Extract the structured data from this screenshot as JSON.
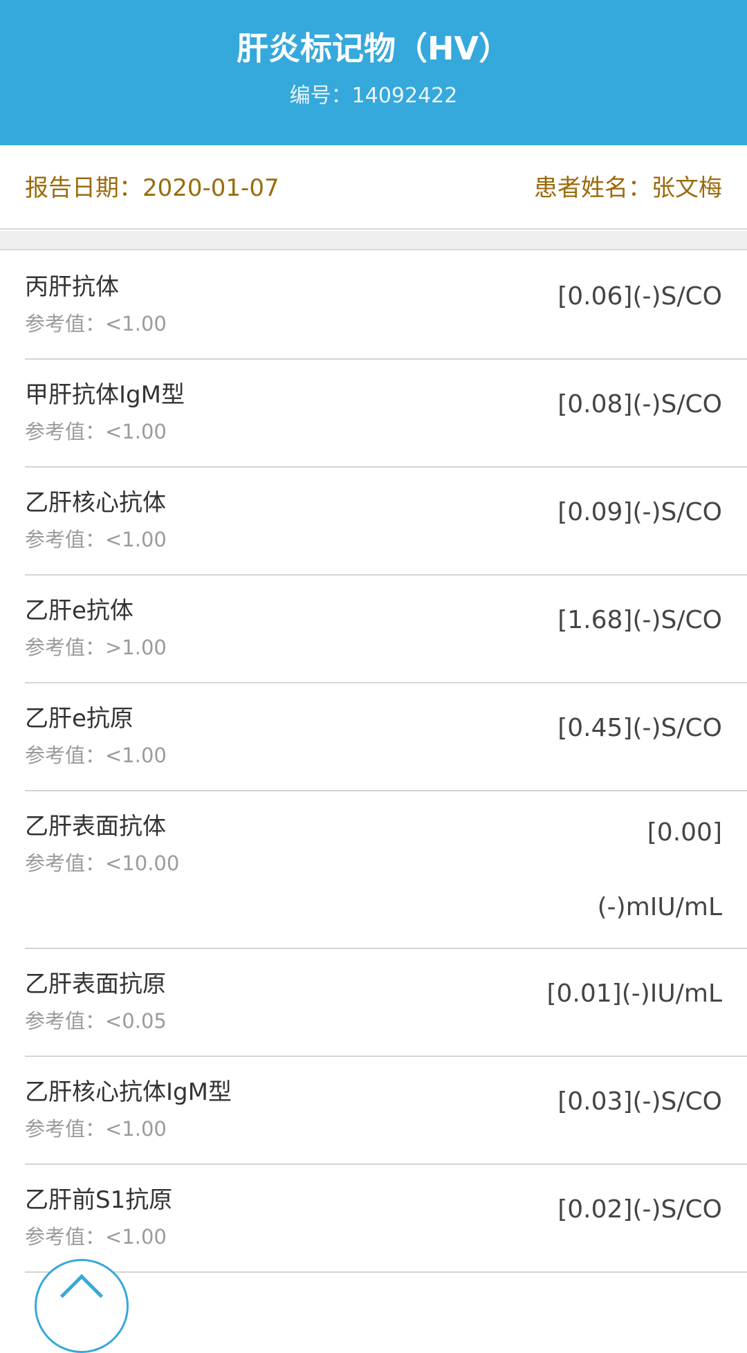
{
  "header": {
    "title": "肝炎标记物（HV）",
    "subtitle": "编号：14092422"
  },
  "info": {
    "report_date": "报告日期：2020-01-07",
    "patient_name": "患者姓名：张文梅"
  },
  "items": [
    {
      "name": "丙肝抗体",
      "reference": "参考值：<1.00",
      "value": "[0.06](-)S/CO"
    },
    {
      "name": "甲肝抗体IgM型",
      "reference": "参考值：<1.00",
      "value": "[0.08](-)S/CO"
    },
    {
      "name": "乙肝核心抗体",
      "reference": "参考值：<1.00",
      "value": "[0.09](-)S/CO"
    },
    {
      "name": "乙肝e抗体",
      "reference": "参考值：>1.00",
      "value": "[1.68](-)S/CO"
    },
    {
      "name": "乙肝e抗原",
      "reference": "参考值：<1.00",
      "value": "[0.45](-)S/CO"
    },
    {
      "name": "乙肝表面抗体",
      "reference": "参考值：<10.00",
      "value": "[0.00](-)mIU/mL"
    },
    {
      "name": "乙肝表面抗原",
      "reference": "参考值：<0.05",
      "value": "[0.01](-)IU/mL"
    },
    {
      "name": "乙肝核心抗体IgM型",
      "reference": "参考值：<1.00",
      "value": "[0.03](-)S/CO"
    },
    {
      "name": "乙肝前S1抗原",
      "reference": "参考值：<1.00",
      "value": "[0.02](-)S/CO"
    }
  ],
  "colors": {
    "header_bg": "#35a8dc",
    "info_text": "#9a6b0c"
  },
  "icons": {
    "fab": "chevron-up-icon"
  }
}
